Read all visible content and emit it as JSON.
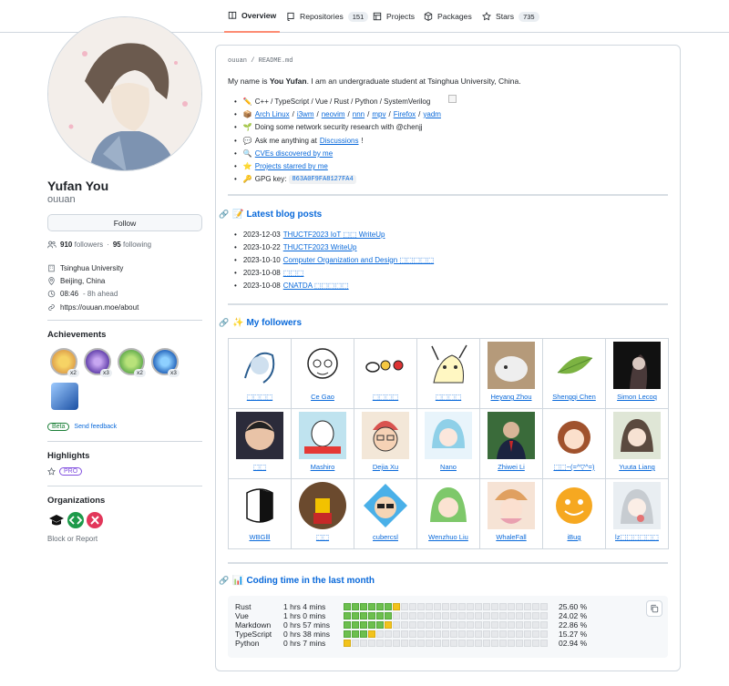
{
  "nav": {
    "tabs": [
      {
        "label": "Overview",
        "icon": "book-icon",
        "count": ""
      },
      {
        "label": "Repositories",
        "icon": "repo-icon",
        "count": "151"
      },
      {
        "label": "Projects",
        "icon": "table-icon",
        "count": ""
      },
      {
        "label": "Packages",
        "icon": "package-icon",
        "count": ""
      },
      {
        "label": "Stars",
        "icon": "star-icon",
        "count": "735"
      }
    ],
    "active_color": "#fd8c73"
  },
  "profile": {
    "name": "Yufan You",
    "login": "ouuan",
    "follow_label": "Follow",
    "followers": "910",
    "followers_label": "followers",
    "sep": "·",
    "following": "95",
    "following_label": "following",
    "org": "Tsinghua University",
    "location": "Beijing, China",
    "time": "08:46",
    "time_ahead": "- 8h ahead",
    "website": "https://ouuan.moe/about"
  },
  "achievements": {
    "title": "Achievements",
    "badges": [
      {
        "name": "pull-shark-icon",
        "count": "x2"
      },
      {
        "name": "galaxy-brain-icon",
        "count": "x3"
      },
      {
        "name": "pair-extraordinaire-icon",
        "count": "x2"
      },
      {
        "name": "starstruck-icon",
        "count": "x3"
      },
      {
        "name": "arctic-code-vault-icon",
        "count": ""
      }
    ],
    "beta": "Beta",
    "feedback": "Send feedback"
  },
  "highlights": {
    "title": "Highlights",
    "pro": "PRO"
  },
  "organizations": {
    "title": "Organizations",
    "block": "Block or Report"
  },
  "readme": {
    "path_user": "ouuan",
    "path_sep": " / ",
    "path_file": "README",
    "path_ext": ".md",
    "intro_pre": "My name is ",
    "intro_name": "You Yufan",
    "intro_post": ". I am an undergraduate student at Tsinghua University, China.",
    "items": [
      {
        "emoji": "✏️",
        "text": "C++ / TypeScript / Vue / Rust / Python / SystemVerilog"
      },
      {
        "emoji": "📦",
        "links": [
          "Arch Linux",
          "i3wm",
          "neovim",
          "nnn",
          "mpv",
          "Firefox",
          "yadm"
        ]
      },
      {
        "emoji": "🌱",
        "text": "Doing some network security research with @chenjj"
      },
      {
        "emoji": "💬",
        "pre": "Ask me anything at ",
        "link": "Discussions",
        "post": "!"
      },
      {
        "emoji": "🔍",
        "link": "CVEs discovered by me"
      },
      {
        "emoji": "⭐",
        "link": "Projects starred by me"
      },
      {
        "emoji": "🔑",
        "pre": "GPG key: ",
        "code": "863A0F9FA8127FA4"
      }
    ],
    "blog": {
      "title": "📝 Latest blog posts",
      "posts": [
        {
          "date": "2023-12-03",
          "title": "THUCTF2023 IoT ⬚⬚ WriteUp"
        },
        {
          "date": "2023-10-22",
          "title": "THUCTF2023 WriteUp"
        },
        {
          "date": "2023-10-10",
          "title": "Computer Organization and Design ⬚⬚⬚⬚⬚"
        },
        {
          "date": "2023-10-08",
          "title": "⬚⬚⬚"
        },
        {
          "date": "2023-10-08",
          "title": "CNATDA ⬚⬚⬚⬚⬚"
        }
      ]
    },
    "followers": {
      "title": "✨ My followers",
      "list": [
        "⬚⬚⬚⬚",
        "Ce Gao",
        "⬚⬚⬚⬚",
        "⬚⬚⬚⬚",
        "Heyang Zhou",
        "Shengqi Chen",
        "Simon Lecoq",
        "⬚⬚",
        "Mashiro",
        "Dejia Xu",
        "Nano",
        "Zhiwei Li",
        "⬚⬚~(=^▽^=)",
        "Yuuta Liang",
        "WBGlll",
        "⬚⬚",
        "cubercsl",
        "Wenzhuo Liu",
        "WhaleFall",
        "iBug",
        "lz⬚⬚⬚⬚⬚⬚"
      ]
    },
    "coding": {
      "title": "📊 Coding time in the last month",
      "rows": [
        {
          "lang": "Rust",
          "time": "1 hrs 4 mins",
          "pct": "25.60 %",
          "green": 6,
          "yellow": 1
        },
        {
          "lang": "Vue",
          "time": "1 hrs 0 mins",
          "pct": "24.02 %",
          "green": 6,
          "yellow": 0
        },
        {
          "lang": "Markdown",
          "time": "0 hrs 57 mins",
          "pct": "22.86 %",
          "green": 5,
          "yellow": 1
        },
        {
          "lang": "TypeScript",
          "time": "0 hrs 38 mins",
          "pct": "15.27 %",
          "green": 3,
          "yellow": 1
        },
        {
          "lang": "Python",
          "time": "0 hrs 7 mins",
          "pct": "02.94 %",
          "green": 0,
          "yellow": 1
        }
      ]
    }
  }
}
